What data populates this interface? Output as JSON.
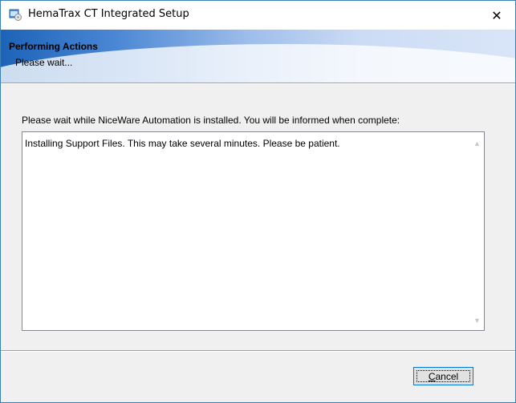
{
  "window": {
    "title": "HemaTrax CT Integrated Setup",
    "icon": "installer-icon",
    "close_glyph": "✕"
  },
  "banner": {
    "title": "Performing Actions",
    "subtitle": "Please wait..."
  },
  "main": {
    "instruction": "Please wait while NiceWare Automation is installed.  You will be informed when complete:",
    "status_text": "Installing Support Files.  This may take several minutes.  Please be patient."
  },
  "footer": {
    "cancel_mnemonic": "C",
    "cancel_rest": "ancel"
  },
  "colors": {
    "accent": "#0078d7",
    "banner_dark": "#1c63b7",
    "banner_light": "#d9e5f8"
  }
}
